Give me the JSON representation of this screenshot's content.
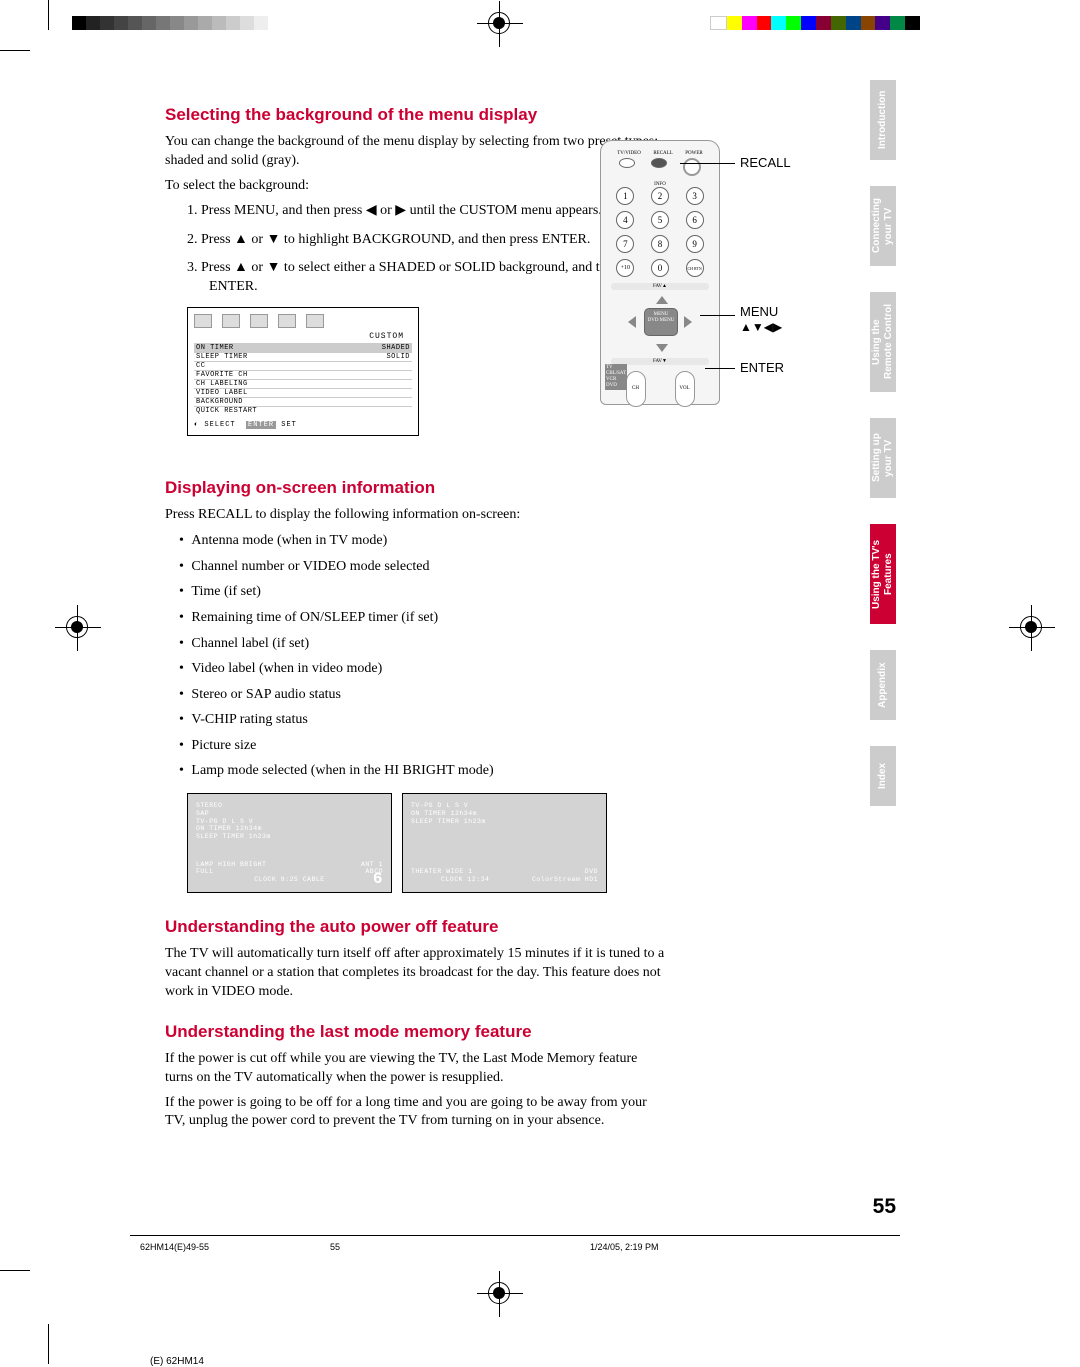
{
  "sections": {
    "background": {
      "heading": "Selecting the background of the menu display",
      "p1": "You can change the background of the menu display by selecting from two preset types: shaded and solid (gray).",
      "p2": "To select the background:",
      "step1_a": "1.",
      "step1_b": "Press MENU, and then press ◀ or ▶ until the CUSTOM menu appears.",
      "step2_a": "2.",
      "step2_b": "Press ▲ or ▼ to highlight BACKGROUND, and then press ENTER.",
      "step3_a": "3.",
      "step3_b": "Press ▲ or ▼ to select either a SHADED or SOLID background, and then press ENTER."
    },
    "menu": {
      "title": "CUSTOM",
      "items": {
        "on_timer": "ON TIMER",
        "sleep_timer": "SLEEP TIMER",
        "cc": "CC",
        "favorite_ch": "FAVORITE CH",
        "ch_labeling": "CH LABELING",
        "video_label": "VIDEO LABEL",
        "background": "BACKGROUND",
        "quick_restart": "QUICK RESTART"
      },
      "values": {
        "shaded": "SHADED",
        "solid": "SOLID"
      },
      "footer_select": "SELECT",
      "footer_enter": "ENTER",
      "footer_set": "SET"
    },
    "recall": {
      "heading": "Displaying on-screen information",
      "intro": "Press RECALL to display the following information on-screen:",
      "bullets": {
        "b1": "Antenna mode (when in TV mode)",
        "b2": "Channel number or VIDEO mode selected",
        "b3": "Time (if set)",
        "b4": "Remaining time of ON/SLEEP timer (if set)",
        "b5": "Channel label (if set)",
        "b6": "Video label (when in video mode)",
        "b7": "Stereo or SAP audio status",
        "b8": "V-CHIP rating status",
        "b9": "Picture size",
        "b10": "Lamp mode selected (when in the HI BRIGHT mode)"
      },
      "box1": {
        "stereo": "STEREO",
        "sap": "SAP",
        "rating": "TV-PG D L S V",
        "on_timer": "ON TIMER     12h34m",
        "sleep_timer": "SLEEP TIMER  1h23m",
        "lamp": "LAMP HIGH BRIGHT",
        "full": "FULL",
        "ant": "ANT 1",
        "abcd": "ABCD",
        "clock": "CLOCK  9:25  CABLE",
        "channel": "6"
      },
      "box2": {
        "rating": "TV-PG D L S V",
        "on_timer": "ON TIMER     12h34m",
        "sleep_timer": "SLEEP TIMER  1h23m",
        "theater": "THEATER WIDE 1",
        "clock": "CLOCK  12:34",
        "dvd": "DVD",
        "cs": "ColorStream HD1"
      }
    },
    "autopower": {
      "heading": "Understanding the auto power off feature",
      "body": "The TV will automatically turn itself off after approximately 15 minutes if it is tuned to a vacant channel or a station that completes its broadcast for the day. This feature does not work in VIDEO mode."
    },
    "lastmode": {
      "heading": "Understanding the last mode memory feature",
      "p1": "If the power is cut off while you are viewing the TV, the Last Mode Memory feature turns on the TV automatically when the power is resupplied.",
      "p2": "If the power is going to be off for a long time and you are going to be away from your TV, unplug the power cord to prevent the TV from turning on in your absence."
    }
  },
  "remote": {
    "labels": {
      "tvvideo": "TV/VIDEO",
      "recall_btn": "RECALL",
      "power": "POWER",
      "info": "INFO",
      "plus10": "+10",
      "chrtn": "CH RTN",
      "fav_up": "FAV▲",
      "fav_down": "FAV▼",
      "menu_center": "MENU",
      "dvdmenu": "DVD MENU",
      "ch": "CH",
      "vol": "VOL",
      "modes": "TV\nCBL/SAT\nVCR\nDVD"
    },
    "numbers": {
      "n1": "1",
      "n2": "2",
      "n3": "3",
      "n4": "4",
      "n5": "5",
      "n6": "6",
      "n7": "7",
      "n8": "8",
      "n9": "9",
      "n0": "0"
    },
    "callouts": {
      "recall": "RECALL",
      "menu": "MENU",
      "arrows": "▲▼◀▶",
      "enter": "ENTER"
    }
  },
  "tabs": {
    "intro": "Introduction",
    "connecting": "Connecting\nyour TV",
    "remote": "Using the\nRemote Control",
    "setting": "Setting up\nyour TV",
    "features": "Using the TV's\nFeatures",
    "appendix": "Appendix",
    "index": "Index"
  },
  "page_number": "55",
  "footer": {
    "file": "62HM14(E)49-55",
    "page": "55",
    "date": "1/24/05, 2:19 PM",
    "model": "(E) 62HM14"
  }
}
